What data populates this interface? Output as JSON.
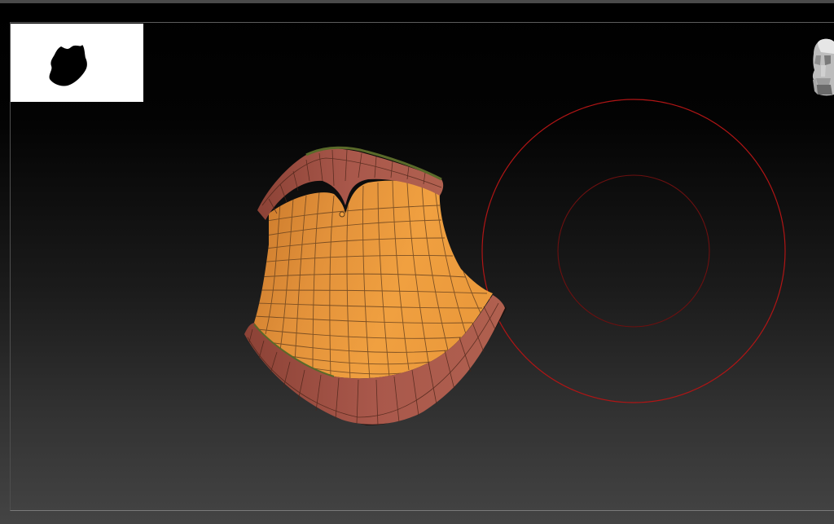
{
  "viewport": {
    "navigator_icon": "silhouette-preview",
    "gizmo_icon": "head-orientation-gizmo"
  },
  "colors": {
    "mesh_fill": "#f0a040",
    "mesh_fill_dark": "#c9782b",
    "rim_fill": "#a9584b",
    "rim_fill_dark": "#8c4236",
    "wire": "#5a3a1a",
    "brush_circle": "#c01818",
    "brush_inner": "#801010",
    "green_edge": "#5a6a2a"
  }
}
